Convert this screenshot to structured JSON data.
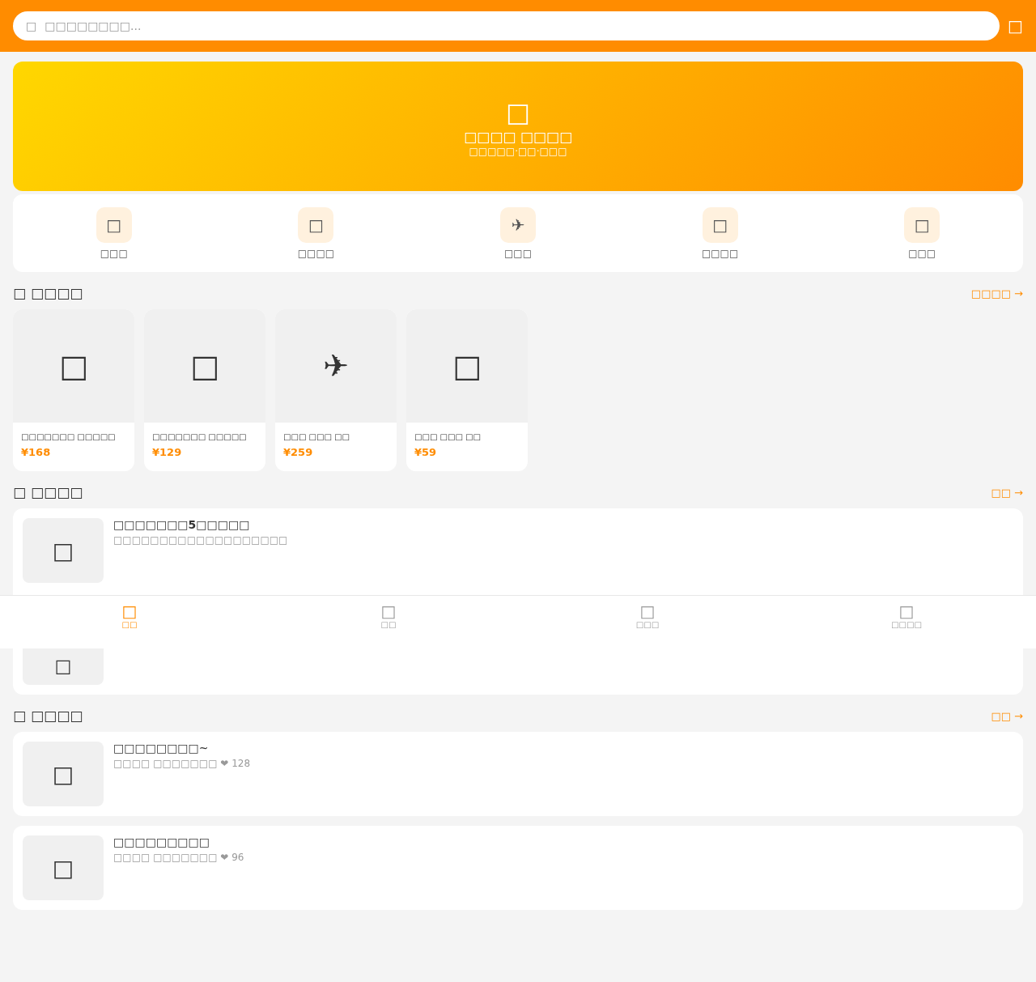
{
  "search": {
    "icon": "□",
    "placeholder": "□□□□□□□□...",
    "scan_icon": "□"
  },
  "banner": {
    "icon": "□",
    "title": "□□□□ □□□□",
    "subtitle": "□□□□□·□□·□□□"
  },
  "categories": [
    {
      "icon": "□",
      "label": "□□□"
    },
    {
      "icon": "□",
      "label": "□□□□"
    },
    {
      "icon": "✈",
      "label": "□□□"
    },
    {
      "icon": "□",
      "label": "□□□□"
    },
    {
      "icon": "□",
      "label": "□□□"
    }
  ],
  "sections": [
    {
      "kind": "products",
      "icon": "□",
      "title": "□□□□",
      "link": "□□□□ →",
      "items": [
        {
          "icon": "□",
          "name": "□□□□□□□ □□□□□",
          "price": "¥168"
        },
        {
          "icon": "□",
          "name": "□□□□□□□ □□□□□",
          "price": "¥129"
        },
        {
          "icon": "✈",
          "name": "□□□ □□□ □□",
          "price": "¥259"
        },
        {
          "icon": "□",
          "name": "□□□ □□□ □□",
          "price": "¥59"
        }
      ]
    },
    {
      "kind": "articles",
      "icon": "□",
      "title": "□□□□",
      "link": "□□ →",
      "items": [
        {
          "icon": "□",
          "title": "□□□□□□□5□□□□□",
          "text": "□□□□□□□□□□□□□□□□□□□"
        },
        {
          "icon": "□"
        }
      ]
    },
    {
      "kind": "posts",
      "icon": "□",
      "title": "□□□□",
      "link": "□□ →",
      "items": [
        {
          "icon": "□",
          "title": "□□□□□□□□~",
          "meta": "□□□□ □□□□□□□ ❤ 128"
        },
        {
          "icon": "□",
          "title": "□□□□□□□□□",
          "meta": "□□□□ □□□□□□□ ❤ 96"
        }
      ]
    }
  ],
  "tabbar": [
    {
      "icon": "□",
      "label": "□□",
      "selected": true
    },
    {
      "icon": "□",
      "label": "□□",
      "selected": false
    },
    {
      "icon": "□",
      "label": "□□□",
      "selected": false
    },
    {
      "icon": "□",
      "label": "□□□□",
      "selected": false
    }
  ]
}
